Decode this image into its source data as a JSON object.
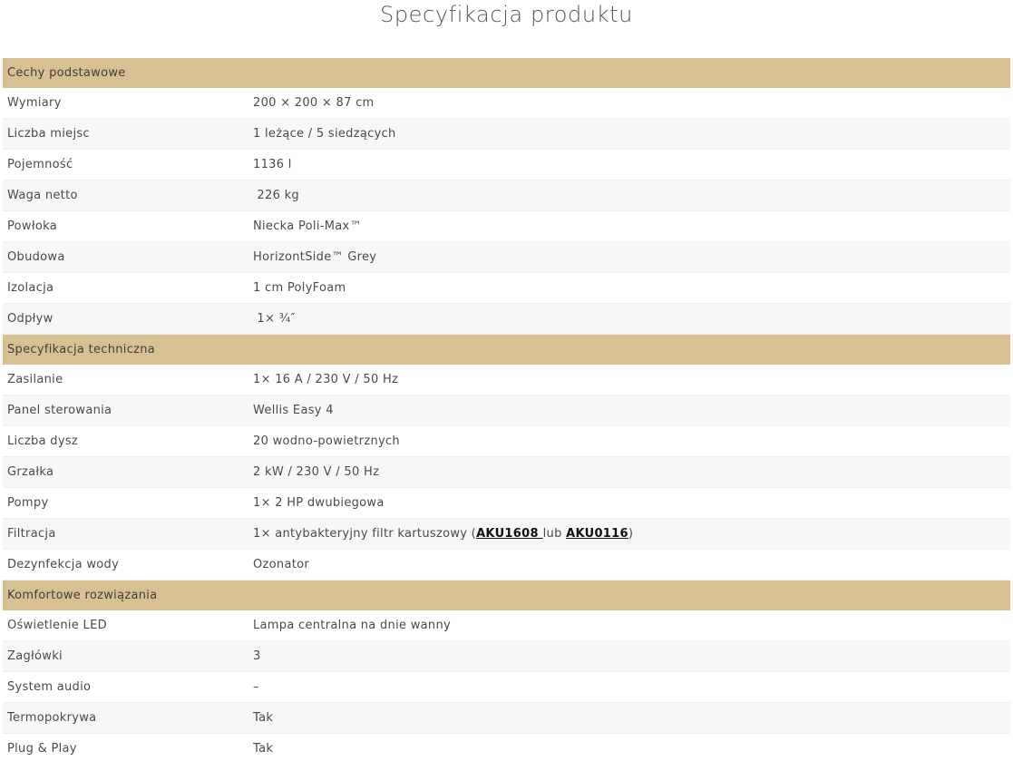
{
  "page": {
    "title": "Specyfikacja produktu"
  },
  "colors": {
    "section_header_bg": "#d7c193",
    "row_alt_bg": "#f7f7f7",
    "text": "#4a4a4a"
  },
  "sections": [
    {
      "title": "Cechy podstawowe",
      "rows": [
        {
          "label": "Wymiary",
          "value": "200 × 200 × 87 cm"
        },
        {
          "label": "Liczba miejsc",
          "value": "1 leżące / 5 siedzących"
        },
        {
          "label": "Pojemność",
          "value": "1136 l"
        },
        {
          "label": "Waga netto",
          "value": " 226 kg"
        },
        {
          "label": "Powłoka",
          "value": "Niecka Poli-Max™"
        },
        {
          "label": "Obudowa",
          "value": "HorizontSide™ Grey"
        },
        {
          "label": "Izolacja",
          "value": "1 cm PolyFoam"
        },
        {
          "label": "Odpływ",
          "value": " 1× ¾″"
        }
      ]
    },
    {
      "title": "Specyfikacja techniczna",
      "rows": [
        {
          "label": "Zasilanie",
          "value": "1× 16 A / 230 V / 50 Hz"
        },
        {
          "label": "Panel sterowania",
          "value": "Wellis Easy 4"
        },
        {
          "label": "Liczba dysz",
          "value": "20 wodno-powietrznych"
        },
        {
          "label": "Grzałka",
          "value": "2 kW / 230 V / 50 Hz"
        },
        {
          "label": "Pompy",
          "value": "1× 2 HP dwubiegowa"
        },
        {
          "label": "Filtracja",
          "value_prefix": "1× antybakteryjny filtr kartuszowy (",
          "link1": "AKU1608 ",
          "value_mid": "lub ",
          "link2": "AKU0116",
          "value_suffix": ")"
        },
        {
          "label": "Dezynfekcja wody",
          "value": "Ozonator"
        }
      ]
    },
    {
      "title": "Komfortowe rozwiązania",
      "rows": [
        {
          "label": "Oświetlenie LED",
          "value": "Lampa centralna na dnie wanny"
        },
        {
          "label": "Zagłówki",
          "value": "3"
        },
        {
          "label": "System audio",
          "value": "–"
        },
        {
          "label": "Termopokrywa",
          "value": "Tak"
        },
        {
          "label": "Plug & Play",
          "value": "Tak"
        }
      ]
    }
  ]
}
